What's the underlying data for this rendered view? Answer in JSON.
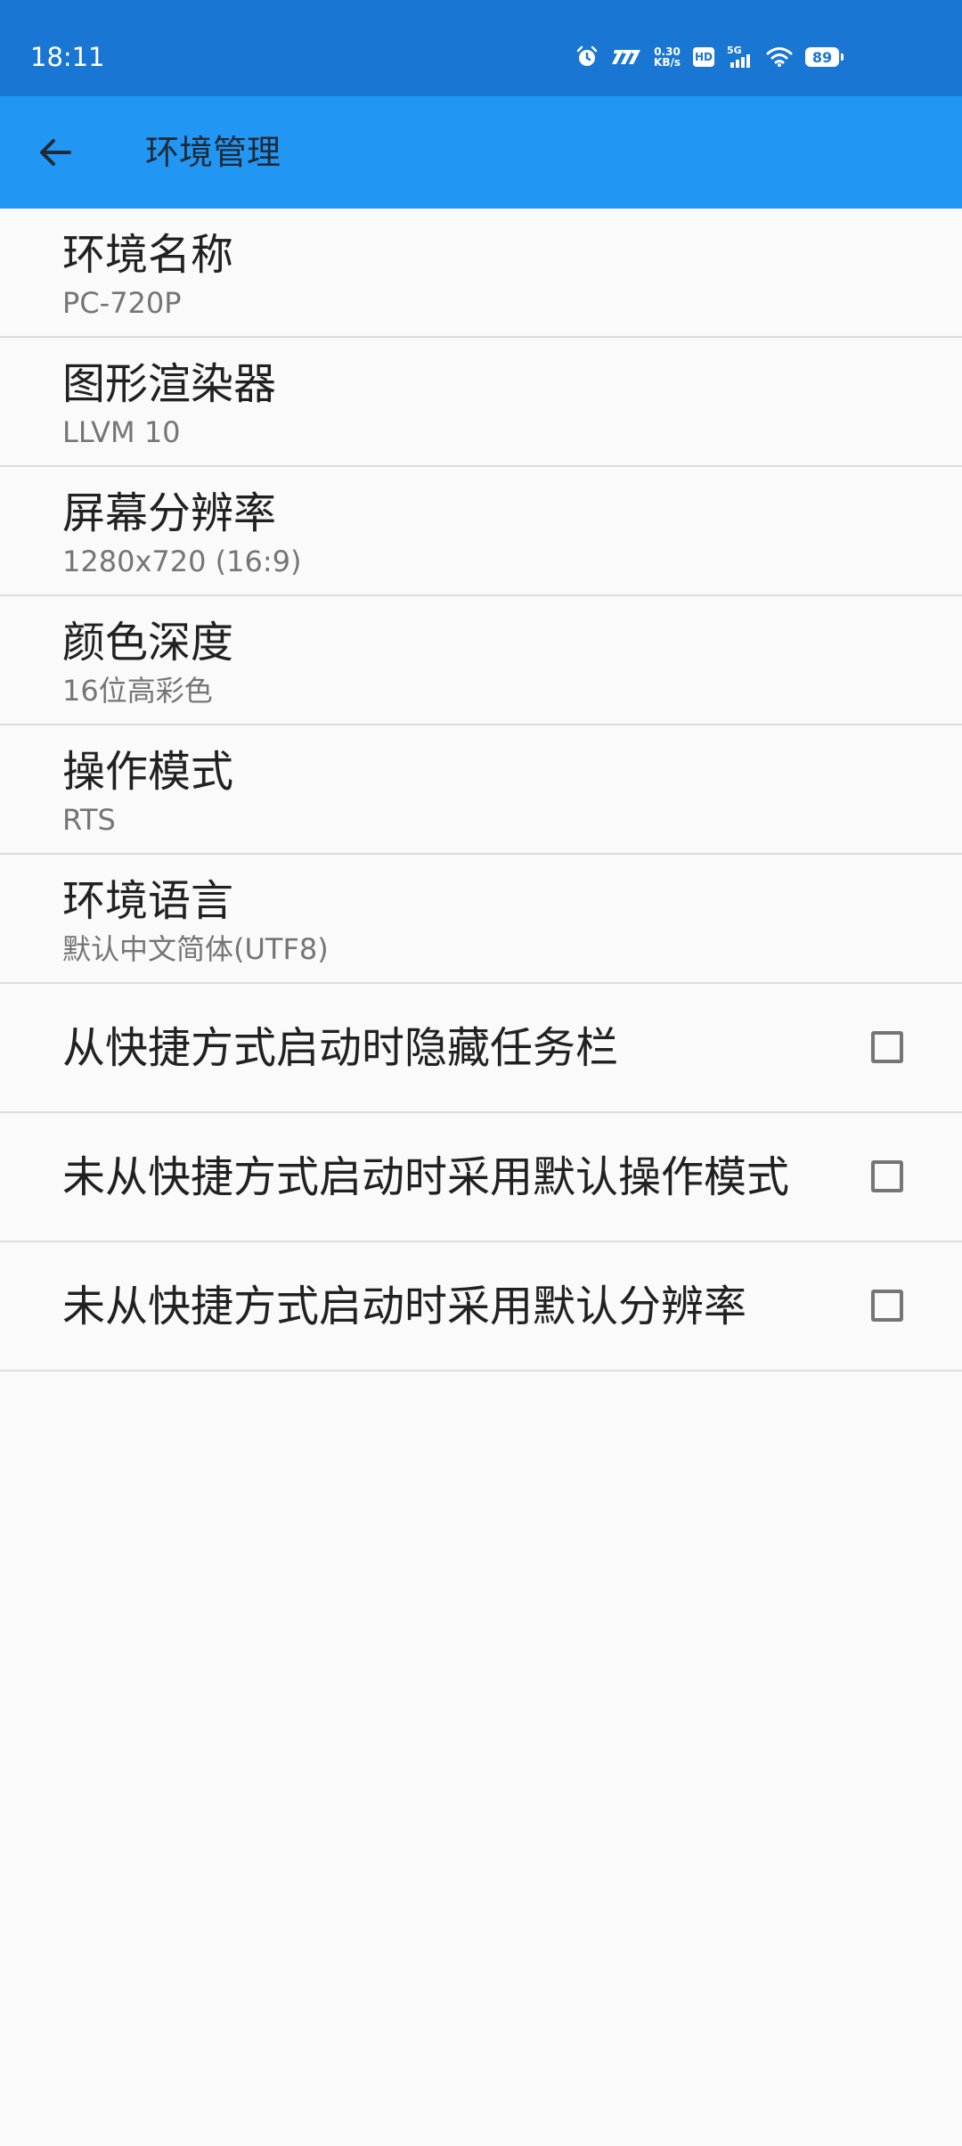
{
  "status_bar": {
    "time": "18:11",
    "network_speed_value": "0.30",
    "network_speed_unit": "KB/s",
    "hd_label": "HD",
    "signal_label": "5G",
    "battery_level": "89",
    "icons": [
      "alarm-icon",
      "carrier-logo-icon",
      "signal-bars-icon",
      "wifi-icon",
      "battery-icon"
    ]
  },
  "app_bar": {
    "title": "环境管理",
    "back_icon": "arrow-left-icon"
  },
  "settings": {
    "items": [
      {
        "title": "环境名称",
        "summary": "PC-720P"
      },
      {
        "title": "图形渲染器",
        "summary": "LLVM 10"
      },
      {
        "title": "屏幕分辨率",
        "summary": "1280x720 (16:9)"
      },
      {
        "title": "颜色深度",
        "summary": "16位高彩色"
      },
      {
        "title": "操作模式",
        "summary": "RTS"
      },
      {
        "title": "环境语言",
        "summary": "默认中文简体(UTF8)"
      }
    ],
    "checkboxes": [
      {
        "title": "从快捷方式启动时隐藏任务栏",
        "checked": false
      },
      {
        "title": "未从快捷方式启动时采用默认操作模式",
        "checked": false
      },
      {
        "title": "未从快捷方式启动时采用默认分辨率",
        "checked": false
      }
    ]
  },
  "colors": {
    "status_bar": "#1976d2",
    "app_bar": "#2196f3",
    "background": "#fafafa",
    "title_text": "#212121",
    "summary_text": "#757575",
    "divider": "#dcdcdc"
  }
}
